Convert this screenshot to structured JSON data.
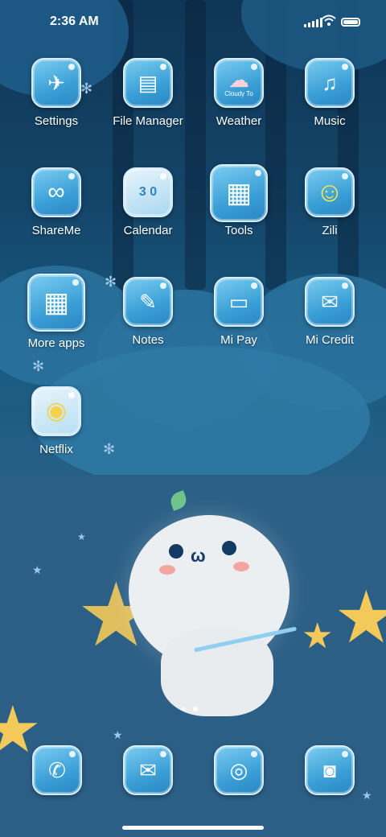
{
  "status_bar": {
    "time": "2:36 AM",
    "icons": [
      "signal-icon",
      "wifi-icon",
      "battery-icon"
    ]
  },
  "apps": [
    {
      "label": "Settings",
      "icon": "settings-icon",
      "glyph": "✈"
    },
    {
      "label": "File Manager",
      "icon": "file-manager-icon",
      "glyph": "▤"
    },
    {
      "label": "Weather",
      "icon": "weather-icon",
      "glyph": "☁",
      "icon_text": "Cloudy To"
    },
    {
      "label": "Music",
      "icon": "music-icon",
      "glyph": "♫"
    },
    {
      "label": "ShareMe",
      "icon": "shareme-icon",
      "glyph": "∞"
    },
    {
      "label": "Calendar",
      "icon": "calendar-icon",
      "glyph": "",
      "icon_text": "3 0"
    },
    {
      "label": "Tools",
      "icon": "tools-folder-icon",
      "glyph": "▦"
    },
    {
      "label": "Zili",
      "icon": "zili-icon",
      "glyph": "☺"
    },
    {
      "label": "More apps",
      "icon": "more-apps-folder-icon",
      "glyph": "▦"
    },
    {
      "label": "Notes",
      "icon": "notes-icon",
      "glyph": "✎"
    },
    {
      "label": "Mi Pay",
      "icon": "mi-pay-icon",
      "glyph": "▭"
    },
    {
      "label": "Mi Credit",
      "icon": "mi-credit-icon",
      "glyph": "✉"
    },
    {
      "label": "Netflix",
      "icon": "netflix-icon",
      "glyph": "◉"
    }
  ],
  "dock": [
    {
      "name": "phone",
      "icon": "phone-icon",
      "glyph": "✆"
    },
    {
      "name": "messages",
      "icon": "messages-icon",
      "glyph": "✉"
    },
    {
      "name": "browser",
      "icon": "browser-icon",
      "glyph": "◎"
    },
    {
      "name": "camera",
      "icon": "camera-icon",
      "glyph": "◙"
    }
  ],
  "pager": {
    "pages": 2,
    "current": 2
  }
}
